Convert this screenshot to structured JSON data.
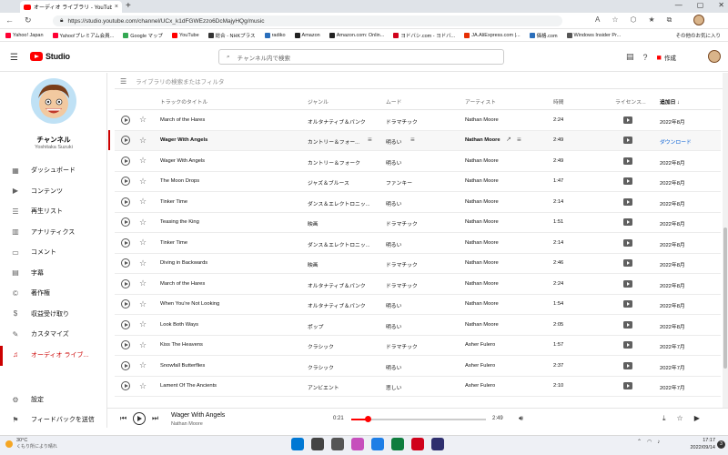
{
  "browser": {
    "tab_title": "オーディオ ライブラリ - YouTube Studio",
    "url": "https://studio.youtube.com/channel/UCx_k1dFGWEzzo6DcMajyHQg/music",
    "bookmarks": [
      {
        "label": "Yahoo! Japan",
        "color": "#ff0033"
      },
      {
        "label": "Yahoo!プレミアム会員...",
        "color": "#ff0033"
      },
      {
        "label": "Google マップ",
        "color": "#34a853"
      },
      {
        "label": "YouTube",
        "color": "#ff0000"
      },
      {
        "label": "総合 - NHKプラス",
        "color": "#333333"
      },
      {
        "label": "radiko",
        "color": "#2a6ebb"
      },
      {
        "label": "Amazon",
        "color": "#222222"
      },
      {
        "label": "Amazon.com: Onlin...",
        "color": "#222222"
      },
      {
        "label": "ヨドバシ.com - ヨドバ...",
        "color": "#d0021b"
      },
      {
        "label": "JA.AliExpress.com |...",
        "color": "#e62e04"
      },
      {
        "label": "価格.com",
        "color": "#2a6ebb"
      },
      {
        "label": "Windows Insider Pr...",
        "color": "#555555"
      }
    ],
    "other_bookmarks": "その他のお気に入り"
  },
  "header": {
    "logo_text": "Studio",
    "search_placeholder": "チャンネル内で検索",
    "create_label": "作成"
  },
  "sidebar": {
    "channel_title": "チャンネル",
    "channel_name": "Yoshitaka Suzuki",
    "items": [
      {
        "label": "ダッシュボード",
        "icon": "dashboard-icon",
        "glyph": "▦"
      },
      {
        "label": "コンテンツ",
        "icon": "content-icon",
        "glyph": "▶"
      },
      {
        "label": "再生リスト",
        "icon": "playlist-icon",
        "glyph": "☰"
      },
      {
        "label": "アナリティクス",
        "icon": "analytics-icon",
        "glyph": "▥"
      },
      {
        "label": "コメント",
        "icon": "comment-icon",
        "glyph": "▭"
      },
      {
        "label": "字幕",
        "icon": "subtitles-icon",
        "glyph": "▤"
      },
      {
        "label": "著作権",
        "icon": "copyright-icon",
        "glyph": "©"
      },
      {
        "label": "収益受け取り",
        "icon": "monetization-icon",
        "glyph": "$"
      },
      {
        "label": "カスタマイズ",
        "icon": "customize-icon",
        "glyph": "✎"
      },
      {
        "label": "オーディオ ライブ...",
        "icon": "audio-library-icon",
        "glyph": "♫"
      }
    ],
    "settings_label": "設定",
    "feedback_label": "フィードバックを送信"
  },
  "filter": {
    "placeholder": "ライブラリの検索またはフィルタ"
  },
  "table": {
    "headers": {
      "title": "トラックのタイトル",
      "genre": "ジャンル",
      "mood": "ムード",
      "artist": "アーティスト",
      "duration": "時間",
      "license": "ライセンス...",
      "added": "追加日"
    },
    "rows": [
      {
        "title": "March of the Hares",
        "genre": "オルタナティブ＆パンク",
        "mood": "ドラマチック",
        "artist": "Nathan Moore",
        "duration": "2:24",
        "added": "2022年8月"
      },
      {
        "title": "Wager With Angels",
        "genre": "カントリー＆フォー...",
        "mood": "明るい",
        "artist": "Nathan Moore",
        "duration": "2:49",
        "added": "ダウンロード"
      },
      {
        "title": "Wager With Angels",
        "genre": "カントリー＆フォーク",
        "mood": "明るい",
        "artist": "Nathan Moore",
        "duration": "2:49",
        "added": "2022年8月"
      },
      {
        "title": "The Moon Drops",
        "genre": "ジャズ＆ブルース",
        "mood": "ファンキー",
        "artist": "Nathan Moore",
        "duration": "1:47",
        "added": "2022年8月"
      },
      {
        "title": "Tinker Time",
        "genre": "ダンス＆エレクトロニッ...",
        "mood": "明るい",
        "artist": "Nathan Moore",
        "duration": "2:14",
        "added": "2022年8月"
      },
      {
        "title": "Teasing the King",
        "genre": "映画",
        "mood": "ドラマチック",
        "artist": "Nathan Moore",
        "duration": "1:51",
        "added": "2022年8月"
      },
      {
        "title": "Tinker Time",
        "genre": "ダンス＆エレクトロニッ...",
        "mood": "明るい",
        "artist": "Nathan Moore",
        "duration": "2:14",
        "added": "2022年8月"
      },
      {
        "title": "Diving in Backwards",
        "genre": "映画",
        "mood": "ドラマチック",
        "artist": "Nathan Moore",
        "duration": "2:46",
        "added": "2022年8月"
      },
      {
        "title": "March of the Hares",
        "genre": "オルタナティブ＆パンク",
        "mood": "ドラマチック",
        "artist": "Nathan Moore",
        "duration": "2:24",
        "added": "2022年8月"
      },
      {
        "title": "When You're Not Looking",
        "genre": "オルタナティブ＆パンク",
        "mood": "明るい",
        "artist": "Nathan Moore",
        "duration": "1:54",
        "added": "2022年8月"
      },
      {
        "title": "Look Both Ways",
        "genre": "ポップ",
        "mood": "明るい",
        "artist": "Nathan Moore",
        "duration": "2:05",
        "added": "2022年8月"
      },
      {
        "title": "Kiss The Heavens",
        "genre": "クラシック",
        "mood": "ドラマチック",
        "artist": "Asher Fulero",
        "duration": "1:57",
        "added": "2022年7月"
      },
      {
        "title": "Snowfall Butterflies",
        "genre": "クラシック",
        "mood": "明るい",
        "artist": "Asher Fulero",
        "duration": "2:37",
        "added": "2022年7月"
      },
      {
        "title": "Lament Of The Ancients",
        "genre": "アンビエント",
        "mood": "悲しい",
        "artist": "Asher Fulero",
        "duration": "2:10",
        "added": "2022年7月"
      }
    ],
    "highlight_index": 1
  },
  "player": {
    "title": "Wager With Angels",
    "artist": "Nathan Moore",
    "current": "0:21",
    "total": "2:49",
    "progress": 0.124
  },
  "taskbar": {
    "weather_temp": "30°C",
    "weather_desc": "くもり所により晴れ",
    "time": "17:17",
    "date": "2022/09/14",
    "badge": "3",
    "apps": [
      "#0078d4",
      "#444444",
      "#555555",
      "#c64fbc",
      "#1e7ee6",
      "#0f7d3e",
      "#d0021b",
      "#2f2f6e"
    ]
  }
}
